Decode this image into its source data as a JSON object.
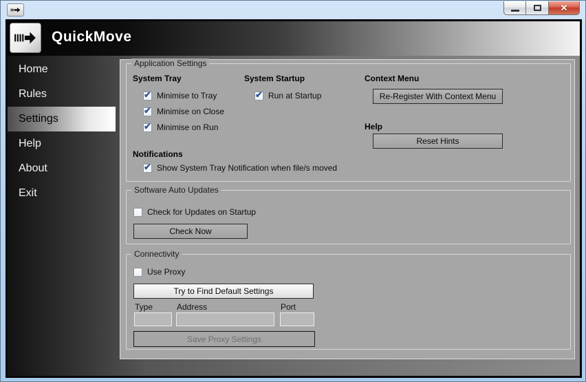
{
  "window": {
    "close_glyph": "✕"
  },
  "header": {
    "title": "QuickMove"
  },
  "sidebar": {
    "items": [
      {
        "label": "Home",
        "selected": false
      },
      {
        "label": "Rules",
        "selected": false
      },
      {
        "label": "Settings",
        "selected": true
      },
      {
        "label": "Help",
        "selected": false
      },
      {
        "label": "About",
        "selected": false
      },
      {
        "label": "Exit",
        "selected": false
      }
    ]
  },
  "app_settings": {
    "title": "Application Settings",
    "system_tray": {
      "heading": "System Tray",
      "items": [
        {
          "label": "Minimise to Tray",
          "checked": true
        },
        {
          "label": "Minimise on Close",
          "checked": true
        },
        {
          "label": "Minimise on Run",
          "checked": true
        }
      ]
    },
    "system_startup": {
      "heading": "System Startup",
      "items": [
        {
          "label": "Run at Startup",
          "checked": true
        }
      ]
    },
    "context_menu": {
      "heading": "Context Menu",
      "button": "Re-Register With Context Menu"
    },
    "help": {
      "heading": "Help",
      "button": "Reset Hints"
    },
    "notifications": {
      "heading": "Notifications",
      "items": [
        {
          "label": "Show System Tray Notification when file/s moved",
          "checked": true
        }
      ]
    }
  },
  "updates": {
    "title": "Software Auto Updates",
    "checkbox": {
      "label": "Check for Updates on Startup",
      "checked": false
    },
    "check_button": "Check Now"
  },
  "connectivity": {
    "title": "Connectivity",
    "checkbox": {
      "label": "Use Proxy",
      "checked": false
    },
    "find_button": "Try to Find Default Settings",
    "fields": [
      {
        "label": "Type",
        "value": ""
      },
      {
        "label": "Address",
        "value": ""
      },
      {
        "label": "Port",
        "value": ""
      }
    ],
    "save_button": "Save Proxy Settings",
    "save_button_enabled": false
  },
  "colors": {
    "aero_blue": "#b9d4ef",
    "panel_gray": "#a6a6a6",
    "check_blue": "#31569b",
    "close_red": "#c03b28",
    "header_gradient_start": "#040404",
    "header_gradient_end": "#f4f4f4"
  }
}
